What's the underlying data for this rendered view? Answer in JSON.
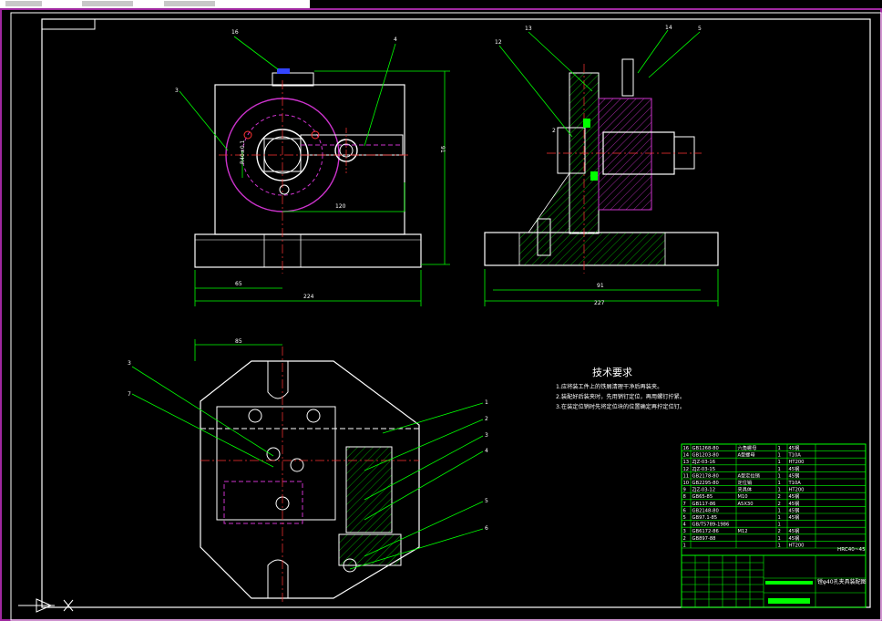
{
  "colors": {
    "background": "#000000",
    "frame": "#ffffff",
    "dims": "#00ff00",
    "hidden": "#cc33cc",
    "hatch": "#00ff00",
    "accent": "#ffff00",
    "outer_border": "#a028a0"
  },
  "icons": {
    "ucs": "ucs-axis-icon"
  },
  "drawing": {
    "balloons": [
      "16",
      "4",
      "3",
      "12",
      "13",
      "14",
      "5",
      "2",
      "3",
      "7",
      "1",
      "2",
      "3",
      "4",
      "5",
      "6"
    ],
    "dimensions": {
      "d_120": "120",
      "d_65": "65",
      "d_224": "224",
      "d_91": "91",
      "d_227": "227",
      "d_85": "85",
      "d_91v": "91",
      "d_r": "R40±0.1"
    }
  },
  "tech_requirements": {
    "title": "技术要求",
    "items": [
      "1.应将装工件上的铁屑清理干净后再装夹。",
      "2.装配好后装夹时，先用销钉定位，再用螺钉拧紧。",
      "3.在装定位销时先将定位块的位置确定再拧定位钉。"
    ]
  },
  "bom": {
    "rows": [
      {
        "no": "16",
        "code": "GB1268-80",
        "name": "六角螺母",
        "qty": "1",
        "mat": "45钢"
      },
      {
        "no": "14",
        "code": "GB1203-80",
        "name": "A型螺母",
        "qty": "1",
        "mat": "T10A"
      },
      {
        "no": "13",
        "code": "ZJZ-03-16",
        "name": "",
        "qty": "1",
        "mat": "HT200"
      },
      {
        "no": "12",
        "code": "ZJZ-03-15",
        "name": "",
        "qty": "1",
        "mat": "45钢"
      },
      {
        "no": "11",
        "code": "GB2178-80",
        "name": "A型定位销",
        "qty": "1",
        "mat": "45钢"
      },
      {
        "no": "10",
        "code": "GB2295-80",
        "name": "定位销",
        "qty": "1",
        "mat": "T10A"
      },
      {
        "no": "9",
        "code": "ZJZ-03-12",
        "name": "夹具体",
        "qty": "1",
        "mat": "HT200"
      },
      {
        "no": "8",
        "code": "GB65-85",
        "name": "M10",
        "qty": "2",
        "mat": "45钢"
      },
      {
        "no": "7",
        "code": "GB117-86",
        "name": "A5X30",
        "qty": "2",
        "mat": "45钢"
      },
      {
        "no": "6",
        "code": "GB2148-80",
        "name": "",
        "qty": "1",
        "mat": "45钢"
      },
      {
        "no": "5",
        "code": "GB97.1-85",
        "name": "",
        "qty": "1",
        "mat": "45钢"
      },
      {
        "no": "4",
        "code": "GB/T5789-1986",
        "name": "",
        "qty": "1",
        "mat": ""
      },
      {
        "no": "3",
        "code": "GB6172-86",
        "name": "M12",
        "qty": "2",
        "mat": "45钢"
      },
      {
        "no": "2",
        "code": "GB897-88",
        "name": "",
        "qty": "1",
        "mat": "45钢"
      },
      {
        "no": "1",
        "code": "",
        "name": "",
        "qty": "1",
        "mat": "HT200"
      }
    ],
    "note_right": "HRC40~45"
  },
  "title_block": {
    "title": "镗φ40孔夹具装配图"
  }
}
